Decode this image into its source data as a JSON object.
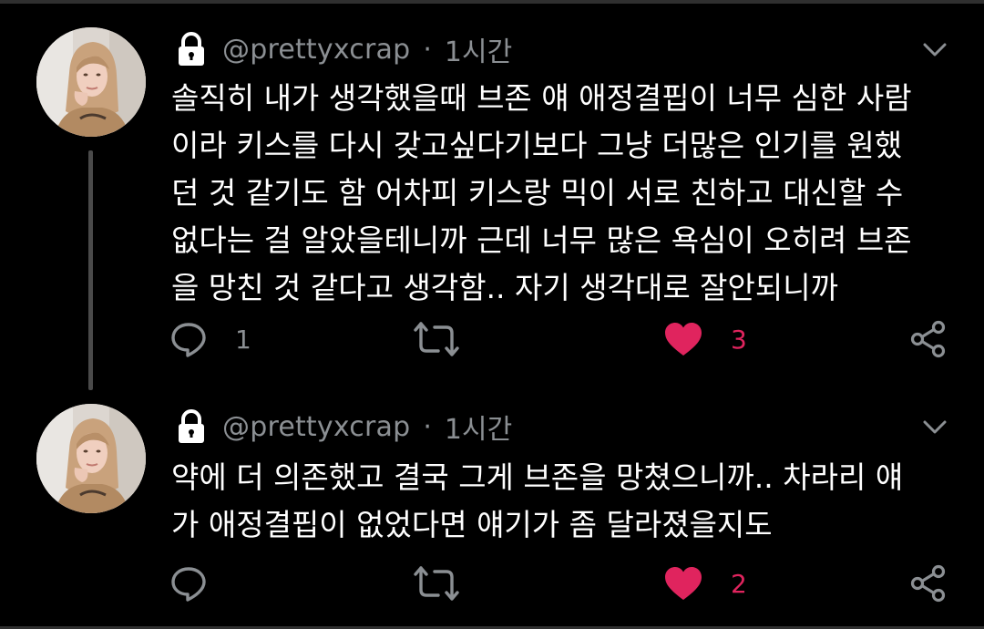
{
  "theme": {
    "background": "#000000",
    "text": "#ffffff",
    "muted": "#8b8f93",
    "like_color": "#e0245e"
  },
  "tweets": [
    {
      "protected_icon": "lock-icon",
      "handle": "@prettyxcrap",
      "separator": "·",
      "time": "1시간",
      "lines": [
        "솔직히 내가 생각했을때 브존 얘 애정결핍이 너무 심한 사람",
        "이라 키스를 다시 갖고싶다기보다 그냥 더많은 인기를 원했",
        "던 것 같기도 함 어차피 키스랑 믹이 서로 친하고 대신할 수",
        "없다는 걸 알았을테니까 근데 너무 많은 욕심이 오히려 브존",
        "을 망친 것 같다고 생각함.. 자기 생각대로 잘안되니까"
      ],
      "reply_count": "1",
      "retweet_count": "",
      "like_count": "3",
      "liked": true
    },
    {
      "protected_icon": "lock-icon",
      "handle": "@prettyxcrap",
      "separator": "·",
      "time": "1시간",
      "lines": [
        "약에 더 의존했고 결국 그게 브존을 망쳤으니까.. 차라리 얘",
        "가 애정결핍이 없었다면 얘기가 좀 달라졌을지도"
      ],
      "reply_count": "",
      "retweet_count": "",
      "like_count": "2",
      "liked": true
    }
  ]
}
